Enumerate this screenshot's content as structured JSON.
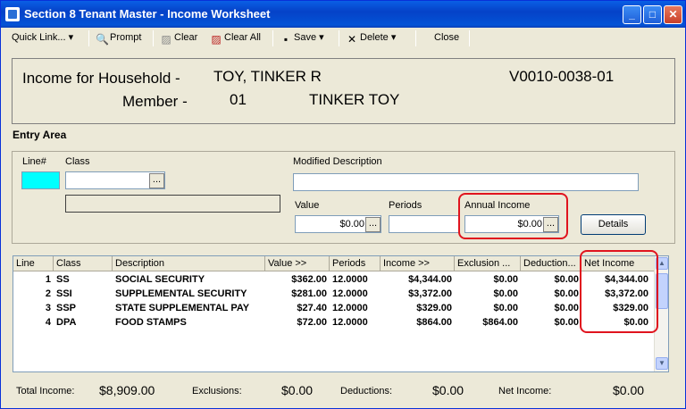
{
  "window": {
    "title": "Section 8 Tenant Master - Income Worksheet",
    "min_icon": "minimize-icon",
    "max_icon": "maximize-icon",
    "close_icon": "close-icon"
  },
  "toolbar": {
    "quick_link": "Quick Link...",
    "prompt": "Prompt",
    "clear": "Clear",
    "clear_all": "Clear All",
    "save": "Save",
    "delete": "Delete",
    "close": "Close"
  },
  "header": {
    "household_label": "Income for Household -",
    "household_name": "TOY, TINKER R",
    "household_id": "V0010-0038-01",
    "member_label": "Member -",
    "member_number": "01",
    "member_name": "TINKER TOY"
  },
  "entry": {
    "section_title": "Entry Area",
    "line_label": "Line#",
    "class_label": "Class",
    "modified_description_label": "Modified Description",
    "value_label": "Value",
    "value": "$0.00",
    "periods_label": "Periods",
    "periods": "",
    "annual_income_label": "Annual Income",
    "annual_income": "$0.00",
    "details_button": "Details",
    "dots": "..."
  },
  "grid": {
    "columns": [
      "Line",
      "Class",
      "Description",
      "Value >>",
      "Periods",
      "Income >>",
      "Exclusion ...",
      "Deduction...",
      "Net Income"
    ],
    "rows": [
      [
        "1",
        "SS",
        "SOCIAL SECURITY",
        "$362.00",
        "12.0000",
        "$4,344.00",
        "$0.00",
        "$0.00",
        "$4,344.00"
      ],
      [
        "2",
        "SSI",
        "SUPPLEMENTAL SECURITY",
        "$281.00",
        "12.0000",
        "$3,372.00",
        "$0.00",
        "$0.00",
        "$3,372.00"
      ],
      [
        "3",
        "SSP",
        "STATE SUPPLEMENTAL PAY",
        "$27.40",
        "12.0000",
        "$329.00",
        "$0.00",
        "$0.00",
        "$329.00"
      ],
      [
        "4",
        "DPA",
        "FOOD STAMPS",
        "$72.00",
        "12.0000",
        "$864.00",
        "$864.00",
        "$0.00",
        "$0.00"
      ]
    ]
  },
  "footer": {
    "total_income_label": "Total Income:",
    "total_income": "$8,909.00",
    "exclusions_label": "Exclusions:",
    "exclusions": "$0.00",
    "deductions_label": "Deductions:",
    "deductions": "$0.00",
    "net_income_label": "Net Income:",
    "net_income": "$0.00"
  },
  "colors": {
    "title_blue": "#0542c8",
    "highlight_red": "#e0141e",
    "line_field_cyan": "#00ffff"
  }
}
